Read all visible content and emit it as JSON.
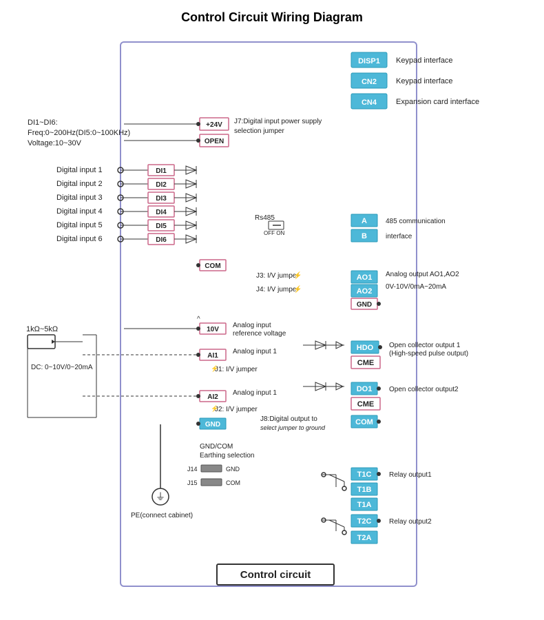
{
  "title": "Control Circuit Wiring Diagram",
  "left_info": {
    "line1": "DI1~DI6:",
    "line2": "Freq:0~200Hz(DI5:0~100KHz)",
    "line3": "Voltage:10~30V"
  },
  "digital_inputs": [
    "Digital input 1",
    "Digital input 2",
    "Digital input 3",
    "Digital input 4",
    "Digital input 5",
    "Digital input 6"
  ],
  "di_terminals": [
    "DI1",
    "DI2",
    "DI3",
    "DI4",
    "DI5",
    "DI6"
  ],
  "power_terminals": [
    "+24V",
    "OPEN",
    "COM"
  ],
  "j7_label": "J7:Digital input power supply selection jumper",
  "analog_section": {
    "range": "1kΩ~5kΩ",
    "dc_label": "DC: 0~10V/0~20mA",
    "terminals": [
      "10V",
      "AI1",
      "AI2",
      "GND"
    ],
    "j1_label": "J1: I/V jumper",
    "j2_label": "J2: I/V jumper",
    "ai1_label": "Analog input 1",
    "ai2_label": "Analog input 1",
    "ref_label": "Analog input\nreference voltage"
  },
  "rs485": {
    "label": "Rs485",
    "switch_label": "OFF ON",
    "terminals": [
      "A",
      "B"
    ],
    "desc": "485 communication\ninterface"
  },
  "analog_outputs": {
    "j3_label": "J3: I/V jumper",
    "j4_label": "J4: I/V jumper",
    "terminals": [
      "AO1",
      "AO2",
      "GND"
    ],
    "desc": "Analog output AO1,AO2\n0V-10V/0mA~20mA"
  },
  "right_interfaces": [
    {
      "terminal": "DISP1",
      "label": "Keypad interface"
    },
    {
      "terminal": "CN2",
      "label": "Keypad interface"
    },
    {
      "terminal": "CN4",
      "label": "Expansion card interface"
    }
  ],
  "collector_outputs": [
    {
      "terminals": [
        "HDO",
        "CME"
      ],
      "desc": "Open collector output 1\n(High-speed pulse output)"
    },
    {
      "terminals": [
        "DO1",
        "CME"
      ],
      "desc": "Open collector output2"
    }
  ],
  "com_terminal": "COM",
  "j8_label": "J8:Digital output to\nselect jumper to ground",
  "gnd_com": {
    "label1": "GND/COM",
    "label2": "Earthing selection",
    "j14_label": "J14",
    "j14_val": "GND",
    "j15_label": "J15",
    "j15_val": "COM"
  },
  "pe_label": "PE(connect cabinet)",
  "relay_outputs": [
    {
      "terminals": [
        "T1C",
        "T1B",
        "T1A"
      ],
      "desc": "Relay output1"
    },
    {
      "terminals": [
        "T2C",
        "T2A"
      ],
      "desc": "Relay output2"
    }
  ],
  "bottom_label": "Control circuit"
}
